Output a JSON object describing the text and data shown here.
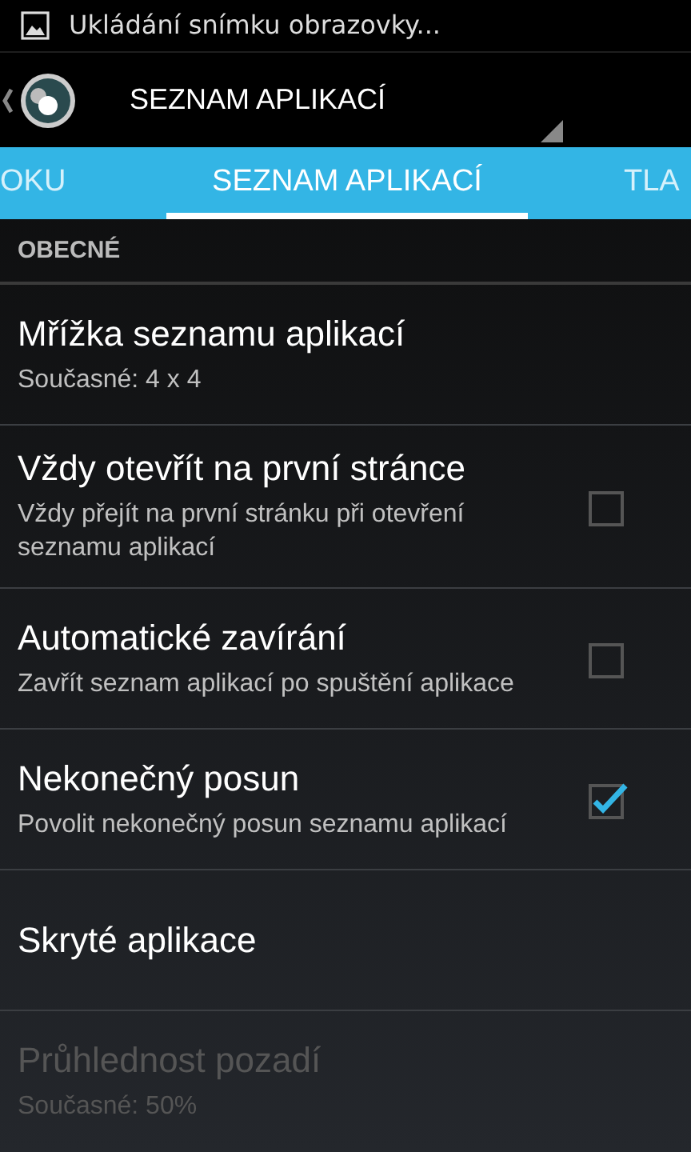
{
  "status_bar": {
    "notification": "Ukládání snímku obrazovky..."
  },
  "action_bar": {
    "title": "SEZNAM APLIKACÍ"
  },
  "tabs": [
    {
      "label": "OKU",
      "selected": false
    },
    {
      "label": "SEZNAM APLIKACÍ",
      "selected": true
    },
    {
      "label": "TLA",
      "selected": false
    }
  ],
  "section": "OBECNÉ",
  "items": [
    {
      "kind": "plain",
      "title": "Mřížka seznamu aplikací",
      "summary": "Současné: 4 x 4",
      "disabled": false
    },
    {
      "kind": "checkbox",
      "title": "Vždy otevřít na první stránce",
      "summary": "Vždy přejít na první stránku při otevření seznamu aplikací",
      "checked": false,
      "disabled": false
    },
    {
      "kind": "checkbox",
      "title": "Automatické zavírání",
      "summary": "Zavřít seznam aplikací po spuštění aplikace",
      "checked": false,
      "disabled": false
    },
    {
      "kind": "checkbox",
      "title": "Nekonečný posun",
      "summary": "Povolit nekonečný posun seznamu aplikací",
      "checked": true,
      "disabled": false
    },
    {
      "kind": "plain",
      "title": "Skryté aplikace",
      "disabled": false
    },
    {
      "kind": "plain",
      "title": "Průhlednost pozadí",
      "summary": "Současné: 50%",
      "disabled": true
    }
  ]
}
